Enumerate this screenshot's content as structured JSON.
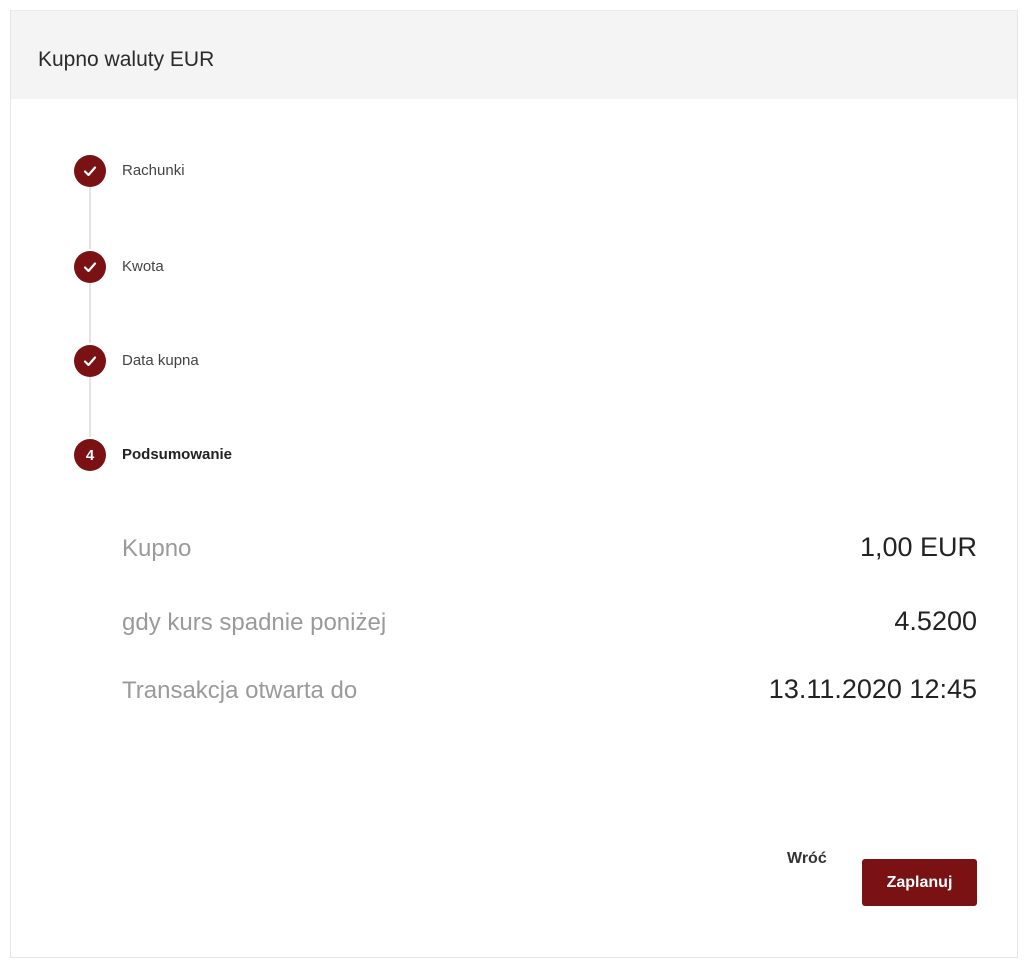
{
  "dialog": {
    "title": "Kupno waluty EUR"
  },
  "stepper": {
    "steps": [
      {
        "label": "Rachunki",
        "state": "completed",
        "icon": "check-icon"
      },
      {
        "label": "Kwota",
        "state": "completed",
        "icon": "check-icon"
      },
      {
        "label": "Data kupna",
        "state": "completed",
        "icon": "check-icon"
      },
      {
        "label": "Podsumowanie",
        "state": "active",
        "number": "4"
      }
    ]
  },
  "summary": {
    "rows": [
      {
        "label": "Kupno",
        "value": "1,00 EUR"
      },
      {
        "label": "gdy kurs spadnie poniżej",
        "value": "4.5200"
      },
      {
        "label": "Transakcja otwarta do",
        "value": "13.11.2020 12:45"
      }
    ]
  },
  "actions": {
    "back_label": "Wróć",
    "submit_label": "Zaplanuj"
  },
  "colors": {
    "accent": "#7a1214",
    "header_background": "#f4f4f4",
    "label_text": "#9a9a9a"
  }
}
